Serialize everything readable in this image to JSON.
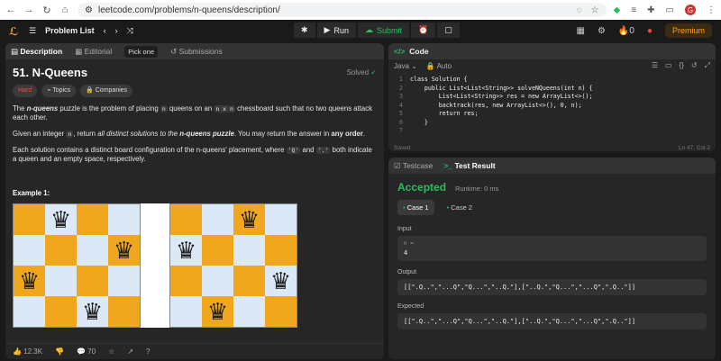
{
  "browser": {
    "url": "leetcode.com/problems/n-queens/description/"
  },
  "topbar": {
    "problem_list": "Problem List",
    "run": "Run",
    "submit": "Submit",
    "coins": "0",
    "premium": "Premium"
  },
  "left_tabs": {
    "description": "Description",
    "editorial": "Editorial",
    "pick_one": "Pick one",
    "submissions": "Submissions"
  },
  "problem": {
    "title": "51. N-Queens",
    "solved": "Solved",
    "difficulty": "Hard",
    "topics": "Topics",
    "companies": "Companies",
    "p1_a": "The ",
    "p1_b": "n-queens",
    "p1_c": " puzzle is the problem of placing ",
    "p1_code1": "n",
    "p1_d": " queens on an ",
    "p1_code2": "n x n",
    "p1_e": " chessboard such that no two queens attack each other.",
    "p2_a": "Given an integer ",
    "p2_code": "n",
    "p2_b": ", return ",
    "p2_c": "all distinct solutions to the ",
    "p2_d": "n-queens puzzle",
    "p2_e": ". You may return the answer in ",
    "p2_f": "any order",
    "p2_g": ".",
    "p3_a": "Each solution contains a distinct board configuration of the n-queens' placement, where ",
    "p3_code1": "'Q'",
    "p3_b": " and ",
    "p3_code2": "'.'",
    "p3_c": " both indicate a queen and an empty space, respectively.",
    "example": "Example 1:",
    "queen_glyph": "♛"
  },
  "footer": {
    "likes": "12.3K",
    "comments": "70"
  },
  "code_panel": {
    "title": "Code",
    "language": "Java",
    "mode": "Auto",
    "saved": "Saved",
    "position": "Ln 47, Col 2",
    "lines": [
      {
        "n": "1",
        "t": "class Solution {"
      },
      {
        "n": "2",
        "t": "    public List<List<String>> solveNQueens(int n) {"
      },
      {
        "n": "3",
        "t": "        List<List<String>> res = new ArrayList<>();"
      },
      {
        "n": "4",
        "t": "        backtrack(res, new ArrayList<>(), 0, n);"
      },
      {
        "n": "5",
        "t": "        return res;"
      },
      {
        "n": "6",
        "t": "    }"
      },
      {
        "n": "7",
        "t": ""
      }
    ]
  },
  "test_panel": {
    "testcase_tab": "Testcase",
    "result_tab": "Test Result",
    "status": "Accepted",
    "runtime": "Runtime: 0 ms",
    "case1": "Case 1",
    "case2": "Case 2",
    "input_label": "Input",
    "input_key": "n =",
    "input_value": "4",
    "output_label": "Output",
    "output_value": "[[\".Q..\",\"...Q\",\"Q...\",\"..Q.\"],[\"..Q.\",\"Q...\",\"...Q\",\".Q..\"]]",
    "expected_label": "Expected",
    "expected_value": "[[\".Q..\",\"...Q\",\"Q...\",\"..Q.\"],[\"..Q.\",\"Q...\",\"...Q\",\".Q..\"]]"
  }
}
